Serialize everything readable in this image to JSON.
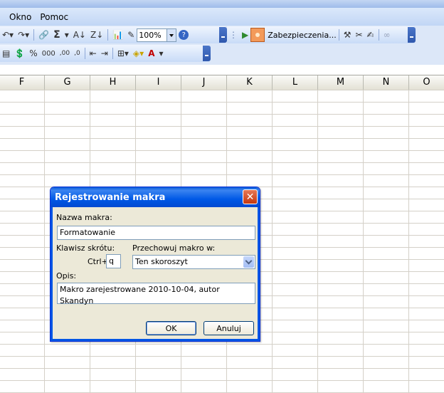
{
  "menu": {
    "items": [
      {
        "label": "Okno"
      },
      {
        "label": "Pomoc"
      }
    ]
  },
  "toolbar": {
    "zoom_value": "100%",
    "sigma": "Σ",
    "percent": "%",
    "thousands": "000",
    "dec_inc": ",00",
    "dec_dec": ",0",
    "font_color_letter": "A",
    "security_label": "Zabezpieczenia..."
  },
  "sheet": {
    "columns": [
      "F",
      "G",
      "H",
      "I",
      "J",
      "K",
      "L",
      "M",
      "N",
      "O"
    ]
  },
  "dialog": {
    "title": "Rejestrowanie makra",
    "close_glyph": "✕",
    "macro_name_label": "Nazwa makra:",
    "macro_name_value": "Formatowanie",
    "shortcut_label": "Klawisz skrótu:",
    "ctrl_label": "Ctrl+",
    "shortcut_value": "q",
    "store_label": "Przechowuj makro w:",
    "store_value": "Ten skoroszyt",
    "description_label": "Opis:",
    "description_value": "Makro zarejestrowane 2010-10-04, autor Skandyn",
    "ok_label": "OK",
    "cancel_label": "Anuluj"
  },
  "colors": {
    "titlebar_blue": "#0058e6",
    "close_red": "#d9542a",
    "dialog_bg": "#ece9d8"
  }
}
